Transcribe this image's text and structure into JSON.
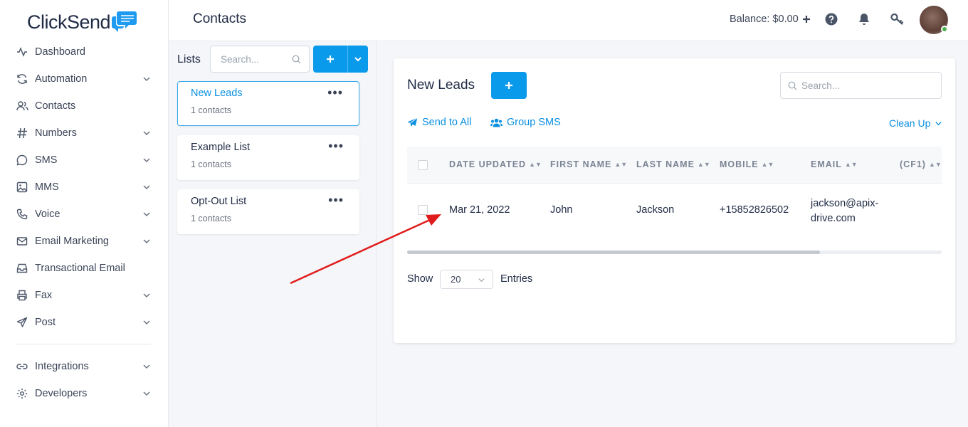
{
  "brand": {
    "name": "ClickSend"
  },
  "sidebar": {
    "items": [
      {
        "label": "Dashboard",
        "icon": "activity-icon",
        "expandable": false
      },
      {
        "label": "Automation",
        "icon": "refresh-icon",
        "expandable": true
      },
      {
        "label": "Contacts",
        "icon": "users-icon",
        "expandable": false
      },
      {
        "label": "Numbers",
        "icon": "hash-icon",
        "expandable": true
      },
      {
        "label": "SMS",
        "icon": "message-circle-icon",
        "expandable": true
      },
      {
        "label": "MMS",
        "icon": "image-icon",
        "expandable": true
      },
      {
        "label": "Voice",
        "icon": "phone-icon",
        "expandable": true
      },
      {
        "label": "Email Marketing",
        "icon": "mail-icon",
        "expandable": true
      },
      {
        "label": "Transactional Email",
        "icon": "inbox-icon",
        "expandable": false
      },
      {
        "label": "Fax",
        "icon": "printer-icon",
        "expandable": true
      },
      {
        "label": "Post",
        "icon": "send-icon",
        "expandable": true
      }
    ],
    "bottom_items": [
      {
        "label": "Integrations",
        "icon": "link-icon",
        "expandable": true
      },
      {
        "label": "Developers",
        "icon": "settings-icon",
        "expandable": true
      }
    ]
  },
  "header": {
    "title": "Contacts",
    "balance": "Balance: $0.00"
  },
  "lists": {
    "label": "Lists",
    "search_placeholder": "Search...",
    "items": [
      {
        "name": "New Leads",
        "count": "1 contacts",
        "active": true
      },
      {
        "name": "Example List",
        "count": "1 contacts",
        "active": false
      },
      {
        "name": "Opt-Out List",
        "count": "1 contacts",
        "active": false
      }
    ]
  },
  "main": {
    "title": "New Leads",
    "search_placeholder": "Search...",
    "send_to_all": "Send to All",
    "group_sms": "Group SMS",
    "clean_up": "Clean Up",
    "columns": [
      "DATE UPDATED",
      "FIRST NAME",
      "LAST NAME",
      "MOBILE",
      "EMAIL",
      "(CF1)"
    ],
    "rows": [
      {
        "date": "Mar 21, 2022",
        "first": "John",
        "last": "Jackson",
        "mobile": "+15852826502",
        "email_line1": "jackson@apix-",
        "email_line2": "drive.com"
      }
    ],
    "show_label": "Show",
    "entries_value": "20",
    "entries_label": "Entries"
  },
  "colors": {
    "accent": "#0a9aeb",
    "link": "#0a8fe0",
    "annotation_arrow": "#e01b1b"
  }
}
